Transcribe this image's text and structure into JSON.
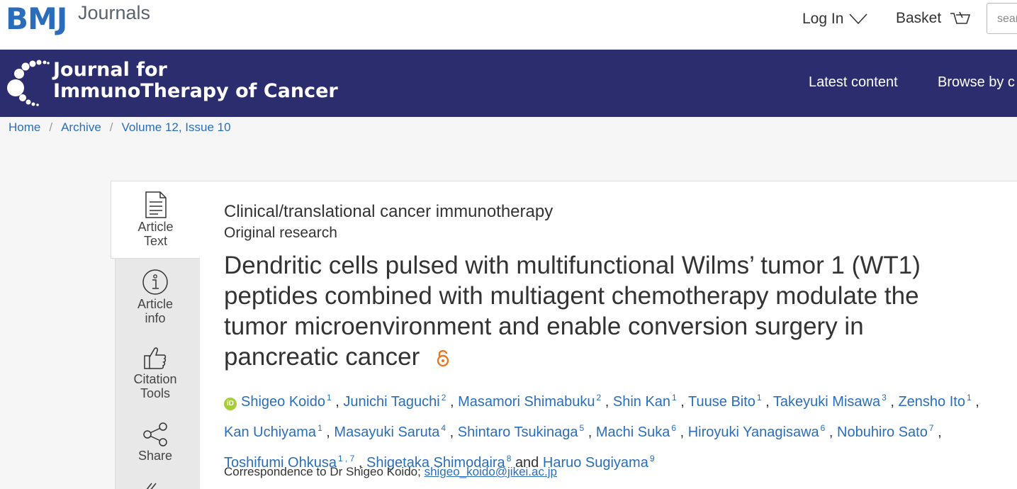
{
  "top": {
    "brand": "BMJ",
    "journals": "Journals",
    "login": "Log In",
    "basket": "Basket",
    "search_placeholder": "search"
  },
  "header": {
    "journal_line1": "Journal for",
    "journal_line2": "ImmunoTherapy of Cancer",
    "nav_latest": "Latest content",
    "nav_browse": "Browse by c"
  },
  "breadcrumb": [
    "Home",
    "Archive",
    "Volume 12, Issue 10"
  ],
  "side_tabs": [
    {
      "line1": "Article",
      "line2": "Text"
    },
    {
      "line1": "Article",
      "line2": "info"
    },
    {
      "line1": "Citation",
      "line2": "Tools"
    },
    {
      "line1": "Share",
      "line2": ""
    }
  ],
  "article": {
    "category": "Clinical/translational cancer immunotherapy",
    "type": "Original research",
    "title": "Dendritic cells pulsed with multifunctional Wilms’ tumor 1 (WT1) peptides combined with multiagent chemotherapy modulate the tumor microenvironment and enable conversion surgery in pancreatic cancer",
    "authors": [
      {
        "name": "Shigeo Koido",
        "aff": "1"
      },
      {
        "name": "Junichi Taguchi",
        "aff": "2"
      },
      {
        "name": "Masamori Shimabuku",
        "aff": "2"
      },
      {
        "name": "Shin Kan",
        "aff": "1"
      },
      {
        "name": "Tuuse Bito",
        "aff": "1"
      },
      {
        "name": "Takeyuki Misawa",
        "aff": "3"
      },
      {
        "name": "Zensho Ito",
        "aff": "1"
      },
      {
        "name": "Kan Uchiyama",
        "aff": "1"
      },
      {
        "name": "Masayuki Saruta",
        "aff": "4"
      },
      {
        "name": "Shintaro Tsukinaga",
        "aff": "5"
      },
      {
        "name": "Machi Suka",
        "aff": "6"
      },
      {
        "name": "Hiroyuki Yanagisawa",
        "aff": "6"
      },
      {
        "name": "Nobuhiro Sato",
        "aff": "7"
      },
      {
        "name": "Toshifumi Ohkusa",
        "aff": "1 , 7"
      },
      {
        "name": "Shigetaka Shimodaira",
        "aff": "8"
      },
      {
        "name": "Haruo Sugiyama",
        "aff": "9"
      }
    ],
    "and_word": "and",
    "correspondence_prefix": "Correspondence to Dr Shigeo Koido;",
    "correspondence_email": "shigeo_koido@jikei.ac.jp"
  },
  "colors": {
    "brand_blue": "#2a6ebb",
    "header_navy": "#2b2d6e",
    "open_access_orange": "#e87722",
    "orcid_green": "#a6ce39"
  }
}
